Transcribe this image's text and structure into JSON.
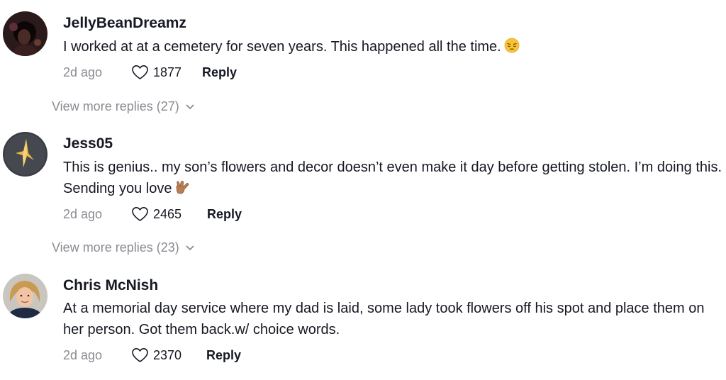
{
  "comments": [
    {
      "username": "JellyBeanDreamz",
      "text": "I worked at at a cemetery for seven years. This happened all the time.",
      "emoji": "pensive-face",
      "time": "2d ago",
      "likes": "1877",
      "reply_label": "Reply",
      "view_more": "View more replies (27)"
    },
    {
      "username": "Jess05",
      "text": "This is genius.. my son’s flowers and decor doesn’t even make it day before getting stolen. I’m doing this. Sending you love",
      "emoji": "love-you-gesture-hand",
      "time": "2d ago",
      "likes": "2465",
      "reply_label": "Reply",
      "view_more": "View more replies (23)"
    },
    {
      "username": "Chris McNish",
      "text": "At a memorial day service where my dad is laid, some lady took flowers off his spot and place them on her person. Got them back.w/ choice words.",
      "time": "2d ago",
      "likes": "2370",
      "reply_label": "Reply"
    }
  ],
  "icons": {
    "like": "heart-outline-icon",
    "expand": "chevron-down-icon"
  },
  "colors": {
    "primary_text": "#161823",
    "secondary_text": "#8a8b91"
  }
}
